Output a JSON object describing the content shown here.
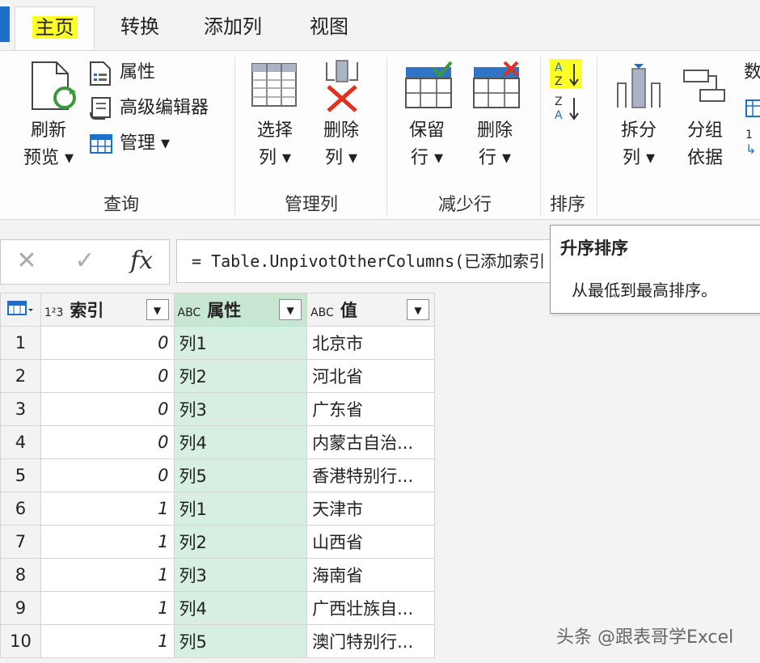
{
  "tabs": {
    "home": "主页",
    "transform": "转换",
    "add_column": "添加列",
    "view": "视图"
  },
  "ribbon": {
    "refresh": {
      "line1": "刷新",
      "line2": "预览 ▾"
    },
    "properties": "属性",
    "advanced_editor": "高级编辑器",
    "manage": "管理 ▾",
    "query_group": "查询",
    "choose_columns": {
      "line1": "选择",
      "line2": "列 ▾"
    },
    "remove_columns": {
      "line1": "删除",
      "line2": "列 ▾"
    },
    "manage_columns_group": "管理列",
    "keep_rows": {
      "line1": "保留",
      "line2": "行 ▾"
    },
    "remove_rows": {
      "line1": "删除",
      "line2": "行 ▾"
    },
    "reduce_rows_group": "减少行",
    "sort_group": "排序",
    "split_column": {
      "line1": "拆分",
      "line2": "列 ▾"
    },
    "group_by": {
      "line1": "分组",
      "line2": "依据"
    },
    "data_type_partial": "数",
    "partial_number": "1"
  },
  "formula_bar": {
    "cancel": "✕",
    "commit": "✓",
    "fx": "fx",
    "formula": "= Table.UnpivotOtherColumns(已添加索引"
  },
  "tooltip": {
    "title": "升序排序",
    "body": "从最低到最高排序。"
  },
  "grid": {
    "columns": [
      {
        "type": "1²3",
        "name": "索引"
      },
      {
        "type": "ABC",
        "name": "属性"
      },
      {
        "type": "ABC",
        "name": "值"
      }
    ],
    "rows": [
      {
        "n": "1",
        "idx": "0",
        "attr": "列1",
        "val": "北京市"
      },
      {
        "n": "2",
        "idx": "0",
        "attr": "列2",
        "val": "河北省"
      },
      {
        "n": "3",
        "idx": "0",
        "attr": "列3",
        "val": "广东省"
      },
      {
        "n": "4",
        "idx": "0",
        "attr": "列4",
        "val": "内蒙古自治..."
      },
      {
        "n": "5",
        "idx": "0",
        "attr": "列5",
        "val": "香港特别行..."
      },
      {
        "n": "6",
        "idx": "1",
        "attr": "列1",
        "val": "天津市"
      },
      {
        "n": "7",
        "idx": "1",
        "attr": "列2",
        "val": "山西省"
      },
      {
        "n": "8",
        "idx": "1",
        "attr": "列3",
        "val": "海南省"
      },
      {
        "n": "9",
        "idx": "1",
        "attr": "列4",
        "val": "广西壮族自..."
      },
      {
        "n": "10",
        "idx": "1",
        "attr": "列5",
        "val": "澳门特别行..."
      }
    ]
  },
  "watermark": "头条 @跟表哥学Excel",
  "colors": {
    "accent": "#1e6fc9",
    "highlight": "#ffff28",
    "selected_col": "#d6efe0",
    "remove_x": "#e0301e"
  }
}
